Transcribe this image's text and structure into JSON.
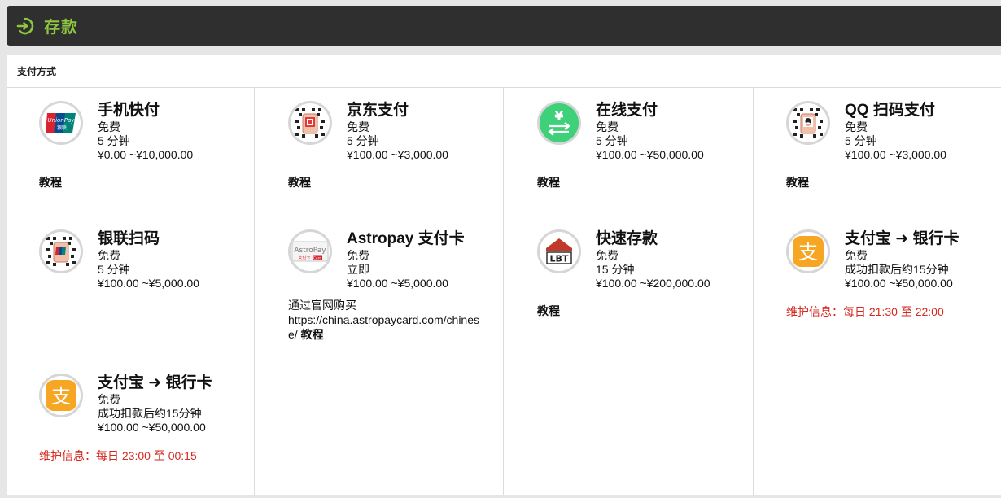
{
  "header": {
    "title": "存款"
  },
  "panel": {
    "title": "支付方式"
  },
  "methods": [
    {
      "name": "手机快付",
      "fee": "免费",
      "time": "5 分钟",
      "range": "¥0.00 ~¥10,000.00",
      "tutorial": "教程",
      "logo_text": "UnionPay 银联"
    },
    {
      "name": "京东支付",
      "fee": "免费",
      "time": "5 分钟",
      "range": "¥100.00 ~¥3,000.00",
      "tutorial": "教程"
    },
    {
      "name": "在线支付",
      "fee": "免费",
      "time": "5 分钟",
      "range": "¥100.00 ~¥50,000.00",
      "tutorial": "教程",
      "logo_text": "¥"
    },
    {
      "name": "QQ 扫码支付",
      "fee": "免费",
      "time": "5 分钟",
      "range": "¥100.00 ~¥3,000.00",
      "tutorial": "教程"
    },
    {
      "name": "银联扫码",
      "fee": "免费",
      "time": "5 分钟",
      "range": "¥100.00 ~¥5,000.00",
      "tutorial": ""
    },
    {
      "name": "Astropay 支付卡",
      "fee": "免费",
      "time": "立即",
      "range": "¥100.00 ~¥5,000.00",
      "desc_prefix": "通过官网购买",
      "desc_url": "https://china.astropaycard.com/chinese/",
      "tutorial": "教程",
      "logo_text": "AstroPay 支付卡 Card"
    },
    {
      "name": "快速存款",
      "fee": "免费",
      "time": "15 分钟",
      "range": "¥100.00 ~¥200,000.00",
      "tutorial": "教程",
      "logo_text": "LBT"
    },
    {
      "name": "支付宝 ➜ 银行卡",
      "fee": "免费",
      "time": "成功扣款后约15分钟",
      "range": "¥100.00 ~¥50,000.00",
      "maintenance": "维护信息：每日 21:30 至 22:00",
      "logo_text": "支"
    },
    {
      "name": "支付宝 ➜ 银行卡",
      "fee": "免费",
      "time": "成功扣款后约15分钟",
      "range": "¥100.00 ~¥50,000.00",
      "maintenance": "维护信息：每日 23:00 至 00:15",
      "logo_text": "支"
    }
  ],
  "colors": {
    "header_bg": "#2f2f2f",
    "header_title": "#8dc63f",
    "maintenance": "#d6281f",
    "alipay": "#f6a623",
    "online_pay": "#3fd07a"
  }
}
